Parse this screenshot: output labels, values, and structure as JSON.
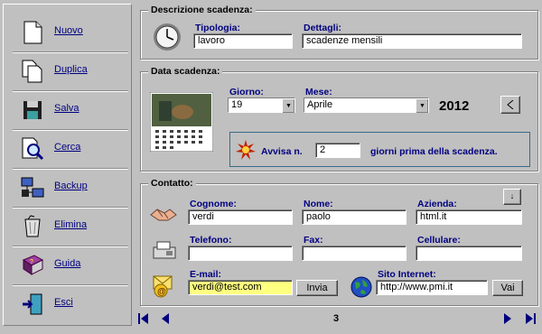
{
  "sidebar": {
    "items": [
      {
        "label": "Nuovo",
        "icon": "new-document-icon"
      },
      {
        "label": "Duplica",
        "icon": "duplicate-documents-icon"
      },
      {
        "label": "Salva",
        "icon": "floppy-disk-icon"
      },
      {
        "label": "Cerca",
        "icon": "magnifier-search-icon"
      },
      {
        "label": "Backup",
        "icon": "backup-network-icon"
      },
      {
        "label": "Elimina",
        "icon": "trash-can-icon"
      },
      {
        "label": "Guida",
        "icon": "help-book-icon"
      },
      {
        "label": "Esci",
        "icon": "exit-door-icon"
      }
    ]
  },
  "descrizione": {
    "title": "Descrizione scadenza:",
    "tipologia_label": "Tipologia:",
    "tipologia_value": "lavoro",
    "dettagli_label": "Dettagli:",
    "dettagli_value": "scadenze mensili"
  },
  "data": {
    "title": "Data scadenza:",
    "giorno_label": "Giorno:",
    "giorno_value": "19",
    "mese_label": "Mese:",
    "mese_value": "Aprile",
    "anno": "2012",
    "avvisa_label": "Avvisa n.",
    "avvisa_value": "2",
    "avvisa_suffix": "giorni prima della scadenza."
  },
  "contatto": {
    "title": "Contatto:",
    "cognome_label": "Cognome:",
    "cognome_value": "verdi",
    "nome_label": "Nome:",
    "nome_value": "paolo",
    "azienda_label": "Azienda:",
    "azienda_value": "html.it",
    "telefono_label": "Telefono:",
    "telefono_value": "",
    "fax_label": "Fax:",
    "fax_value": "",
    "cellulare_label": "Cellulare:",
    "cellulare_value": "",
    "email_label": "E-mail:",
    "email_value": "verdi@test.com",
    "invia_label": "Invia",
    "sito_label": "Sito Internet:",
    "sito_value": "http://www.pmi.it",
    "vai_label": "Vai"
  },
  "pager": {
    "record": "3"
  },
  "colors": {
    "label_blue": "#000080",
    "highlight_yellow": "#ffff80"
  }
}
